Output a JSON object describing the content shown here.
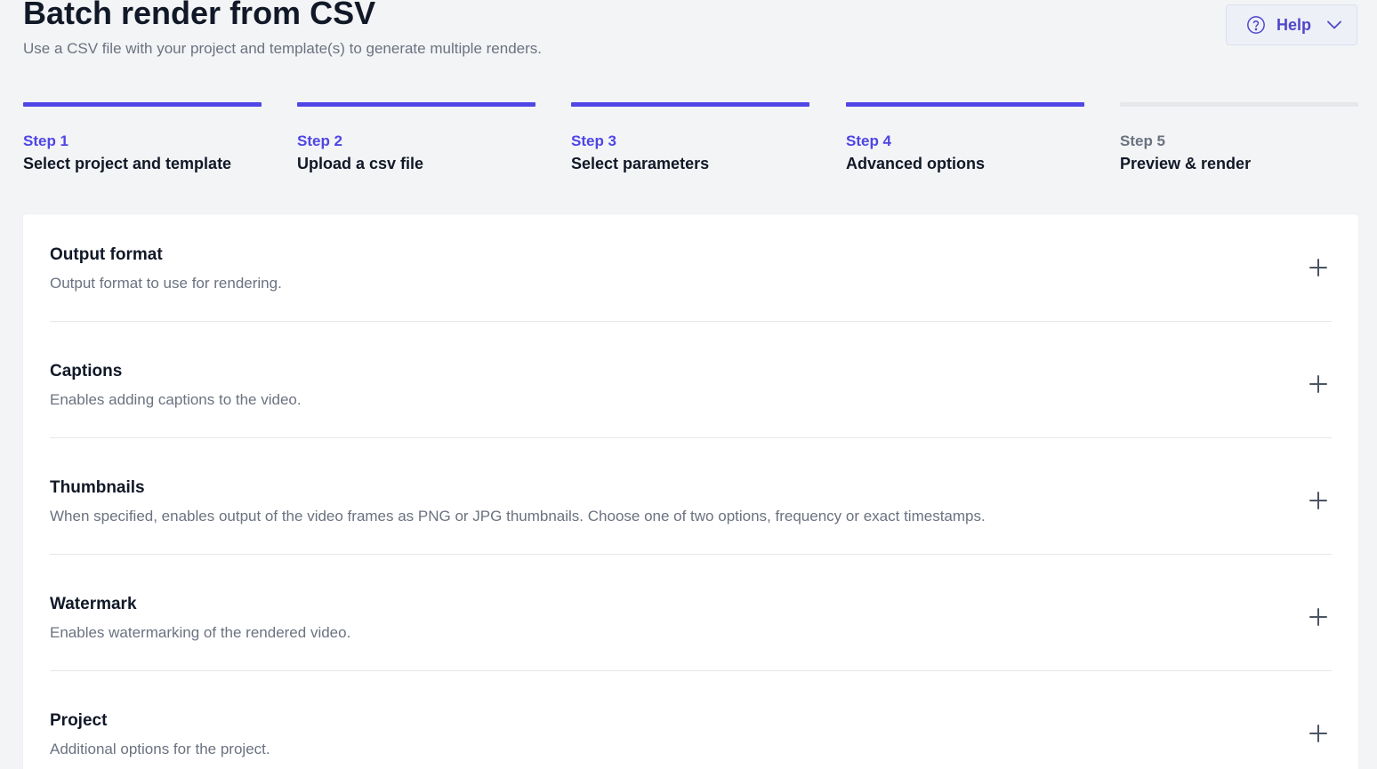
{
  "header": {
    "title": "Batch render from CSV",
    "subtitle": "Use a CSV file with your project and template(s) to generate multiple renders.",
    "help_label": "Help"
  },
  "steps": [
    {
      "number": "Step 1",
      "name": "Select project and template",
      "state": "complete"
    },
    {
      "number": "Step 2",
      "name": "Upload a csv file",
      "state": "complete"
    },
    {
      "number": "Step 3",
      "name": "Select parameters",
      "state": "complete"
    },
    {
      "number": "Step 4",
      "name": "Advanced options",
      "state": "current"
    },
    {
      "number": "Step 5",
      "name": "Preview & render",
      "state": "upcoming"
    }
  ],
  "options": [
    {
      "title": "Output format",
      "description": "Output format to use for rendering.",
      "icon": "plus-icon"
    },
    {
      "title": "Captions",
      "description": "Enables adding captions to the video.",
      "icon": "plus-icon"
    },
    {
      "title": "Thumbnails",
      "description": "When specified, enables output of the video frames as PNG or JPG thumbnails. Choose one of two options, frequency or exact timestamps.",
      "icon": "plus-icon"
    },
    {
      "title": "Watermark",
      "description": "Enables watermarking of the rendered video.",
      "icon": "plus-icon"
    },
    {
      "title": "Project",
      "description": "Additional options for the project.",
      "icon": "plus-icon"
    }
  ],
  "colors": {
    "accent": "#4f46e5",
    "inactive_bar": "#e5e7eb",
    "background": "#f3f4f6",
    "panel": "#ffffff"
  }
}
